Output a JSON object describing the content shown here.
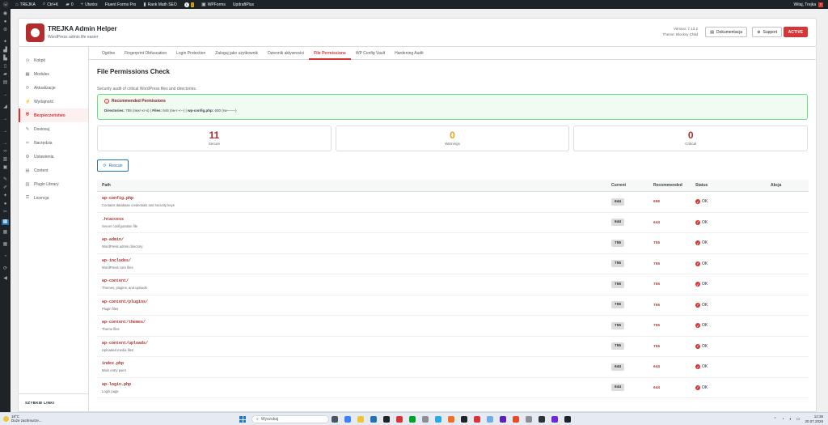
{
  "adminbar": {
    "wp_icon": "wordpress-icon",
    "site": "TREJKA",
    "shortcut": "Ctrl+K",
    "comments": "0",
    "new": "Utwórz",
    "forms": "Fluent Forms Pro",
    "seo": "Rank Math SEO",
    "notif_count": "1",
    "wpforms": "WPForms",
    "updraft": "UpdraftPlus",
    "greeting": "Witaj, Trejka"
  },
  "header": {
    "title": "TREJKA Admin Helper",
    "subtitle": "WordPress admin life easier",
    "version": "Version: 7.13.2",
    "theme": "Theme: Blocksy Child",
    "docs_label": "Dokumentacja",
    "support_label": "Support",
    "status_label": "ACTIVE"
  },
  "sidebar": {
    "items": [
      {
        "label": "Kokpit",
        "icon": "dashboard-icon",
        "glyph": "◷"
      },
      {
        "label": "Modules",
        "icon": "modules-icon",
        "glyph": "▦"
      },
      {
        "label": "Aktualizacje",
        "icon": "updates-icon",
        "glyph": "⟳"
      },
      {
        "label": "Wydajność",
        "icon": "performance-icon",
        "glyph": "⚡"
      },
      {
        "label": "Bezpieczeństwo",
        "icon": "shield-icon",
        "glyph": "⛨"
      },
      {
        "label": "Dostosuj",
        "icon": "customize-icon",
        "glyph": "✎"
      },
      {
        "label": "Narzędzia",
        "icon": "tools-icon",
        "glyph": "✂"
      },
      {
        "label": "Ustawienia",
        "icon": "settings-icon",
        "glyph": "⚙"
      },
      {
        "label": "Content",
        "icon": "content-icon",
        "glyph": "▤"
      },
      {
        "label": "Plugin Library",
        "icon": "library-icon",
        "glyph": "▥"
      },
      {
        "label": "Licencja",
        "icon": "key-icon",
        "glyph": "⚿"
      }
    ],
    "quick_links": "SZYBKIE LINKI"
  },
  "tabs": [
    "Ogólne",
    "Fingerprint Obfuscation",
    "Login Protection",
    "Zaloguj jako użytkownik",
    "Dziennik aktywności",
    "File Permissions",
    "WP Config Vault",
    "Hardening Audit"
  ],
  "active_tab": "File Permissions",
  "page": {
    "title": "File Permissions Check",
    "description": "Security audit of critical WordPress files and directories."
  },
  "recommended": {
    "title": "Recommended Permissions",
    "dirs_label": "Directories:",
    "dirs_value": "755 (rwxr-xr-x)",
    "files_label": "Files:",
    "files_value": "644 (rw-r--r--)",
    "config_label": "wp-config.php:",
    "config_value": "600 (rw-------)",
    "sep": "|"
  },
  "stats": [
    {
      "value": "11",
      "label": "Secure",
      "color": "#b32d2e"
    },
    {
      "value": "0",
      "label": "Warnings",
      "color": "#dba617"
    },
    {
      "value": "0",
      "label": "Critical",
      "color": "#b32d2e"
    }
  ],
  "rescan_label": "Rescan",
  "table": {
    "headers": {
      "path": "Path",
      "current": "Current",
      "recommended": "Recommended",
      "status": "Status",
      "action": "Akcja"
    },
    "rows": [
      {
        "path": "wp-config.php",
        "desc": "Contains database credentials and security keys",
        "current": "644",
        "recommended": "600",
        "status": "OK"
      },
      {
        "path": ".htaccess",
        "desc": "Server configuration file",
        "current": "644",
        "recommended": "644",
        "status": "OK"
      },
      {
        "path": "wp-admin/",
        "desc": "WordPress admin directory",
        "current": "755",
        "recommended": "755",
        "status": "OK"
      },
      {
        "path": "wp-includes/",
        "desc": "WordPress core files",
        "current": "755",
        "recommended": "755",
        "status": "OK"
      },
      {
        "path": "wp-content/",
        "desc": "Themes, plugins, and uploads",
        "current": "755",
        "recommended": "755",
        "status": "OK"
      },
      {
        "path": "wp-content/plugins/",
        "desc": "Plugin files",
        "current": "755",
        "recommended": "755",
        "status": "OK"
      },
      {
        "path": "wp-content/themes/",
        "desc": "Theme files",
        "current": "755",
        "recommended": "755",
        "status": "OK"
      },
      {
        "path": "wp-content/uploads/",
        "desc": "Uploaded media files",
        "current": "755",
        "recommended": "755",
        "status": "OK"
      },
      {
        "path": "index.php",
        "desc": "Main entry point",
        "current": "644",
        "recommended": "644",
        "status": "OK"
      },
      {
        "path": "wp-login.php",
        "desc": "Login page",
        "current": "644",
        "recommended": "644",
        "status": "OK"
      }
    ]
  },
  "taskbar": {
    "temp": "18°C",
    "weather": "Duże zachmurze...",
    "search_placeholder": "Wyszukaj",
    "time": "12:39",
    "date": "20.07.2026"
  }
}
